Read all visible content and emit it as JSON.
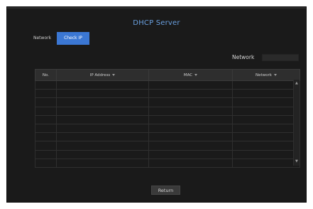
{
  "window": {
    "title": "DHCP Server"
  },
  "tabs": [
    {
      "label": "Network",
      "active": false
    },
    {
      "label": "Check IP",
      "active": true
    }
  ],
  "filter": {
    "label": "Network",
    "value": ""
  },
  "table": {
    "columns": [
      "No.",
      "IP Address",
      "MAC",
      "Network"
    ],
    "rows": [
      [
        "",
        "",
        "",
        ""
      ],
      [
        "",
        "",
        "",
        ""
      ],
      [
        "",
        "",
        "",
        ""
      ],
      [
        "",
        "",
        "",
        ""
      ],
      [
        "",
        "",
        "",
        ""
      ],
      [
        "",
        "",
        "",
        ""
      ],
      [
        "",
        "",
        "",
        ""
      ],
      [
        "",
        "",
        "",
        ""
      ],
      [
        "",
        "",
        "",
        ""
      ],
      [
        "",
        "",
        "",
        ""
      ]
    ]
  },
  "footer": {
    "return_label": "Return"
  },
  "colors": {
    "accent": "#3b77d3",
    "title": "#6aa0e0",
    "background": "#1a1a1a"
  }
}
